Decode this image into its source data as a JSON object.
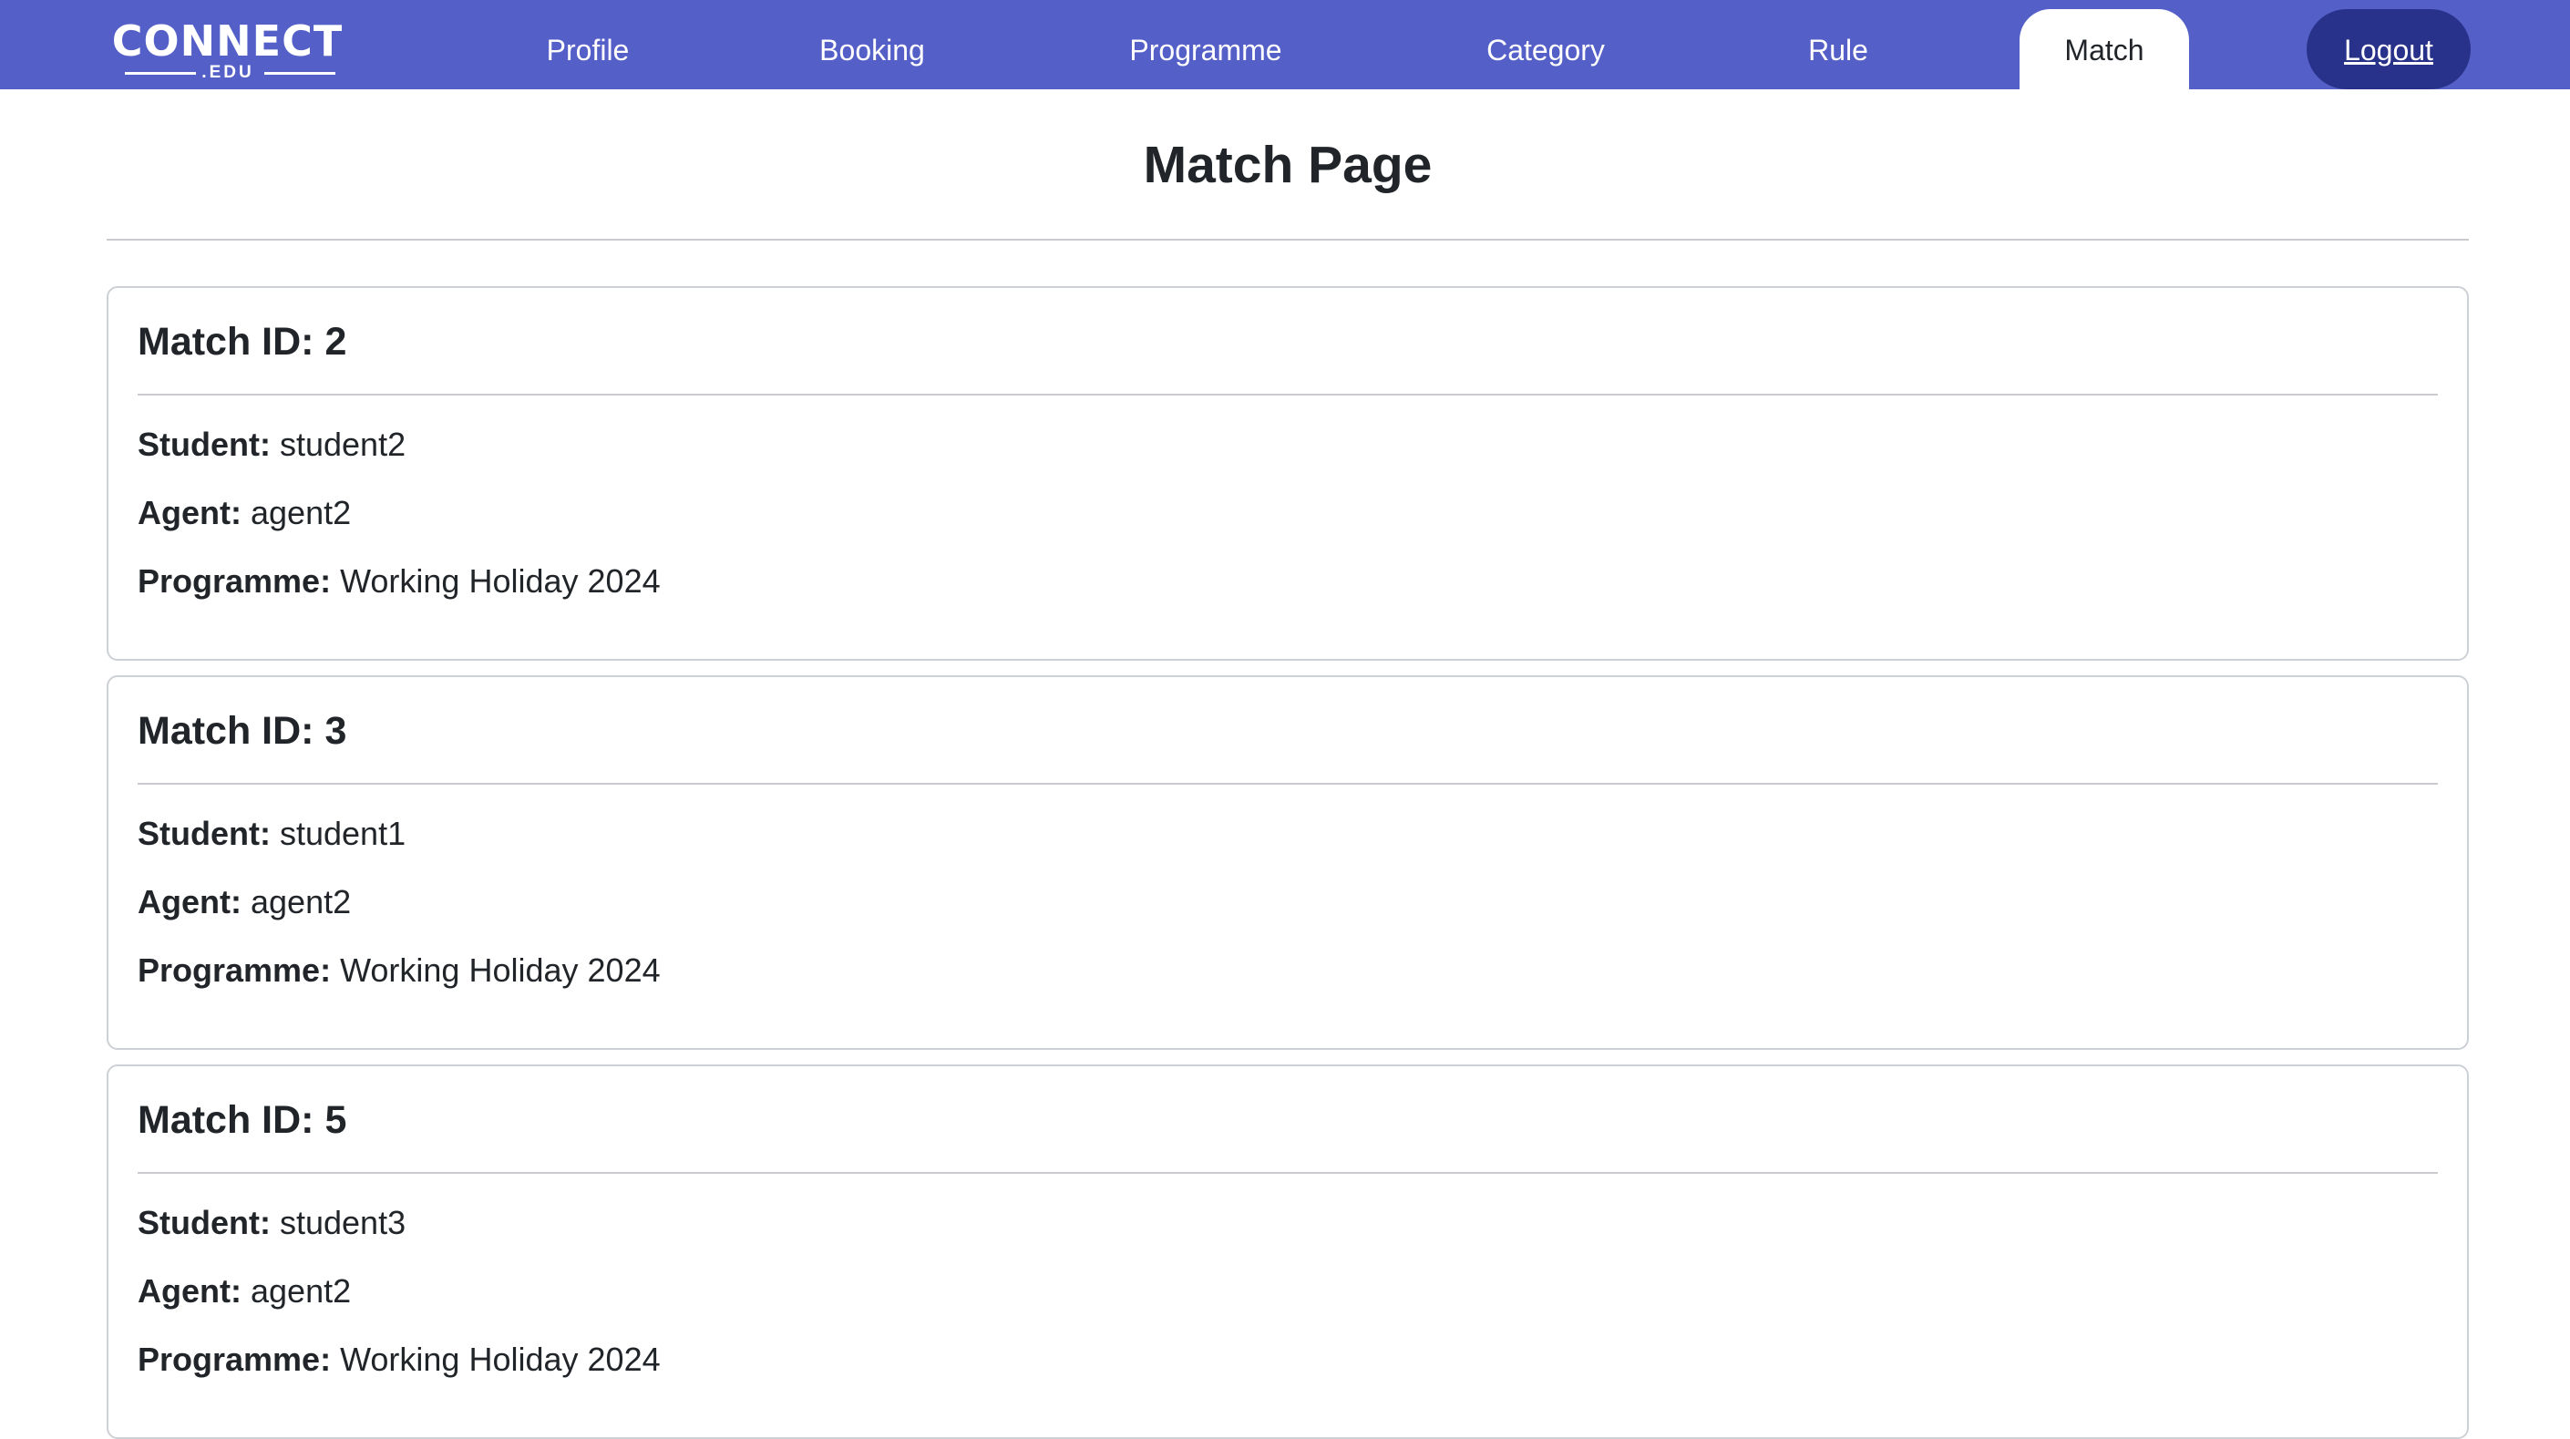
{
  "brand": {
    "name": "CONNECT",
    "sub": ".EDU"
  },
  "nav": {
    "items": [
      {
        "label": "Profile"
      },
      {
        "label": "Booking"
      },
      {
        "label": "Programme"
      },
      {
        "label": "Category"
      },
      {
        "label": "Rule"
      },
      {
        "label": "Match",
        "active": true
      }
    ],
    "logout_label": "Logout"
  },
  "page": {
    "title": "Match Page"
  },
  "labels": {
    "student": "Student:",
    "agent": "Agent:",
    "programme": "Programme:"
  },
  "matches": [
    {
      "heading": "Match ID: 2",
      "student": "student2",
      "agent": "agent2",
      "programme": "Working Holiday 2024"
    },
    {
      "heading": "Match ID: 3",
      "student": "student1",
      "agent": "agent2",
      "programme": "Working Holiday 2024"
    },
    {
      "heading": "Match ID: 5",
      "student": "student3",
      "agent": "agent2",
      "programme": "Working Holiday 2024"
    }
  ],
  "colors": {
    "navbar": "#5460c8",
    "logout_button": "#29328a",
    "active_tab": "#ffffff",
    "text": "#212529"
  }
}
